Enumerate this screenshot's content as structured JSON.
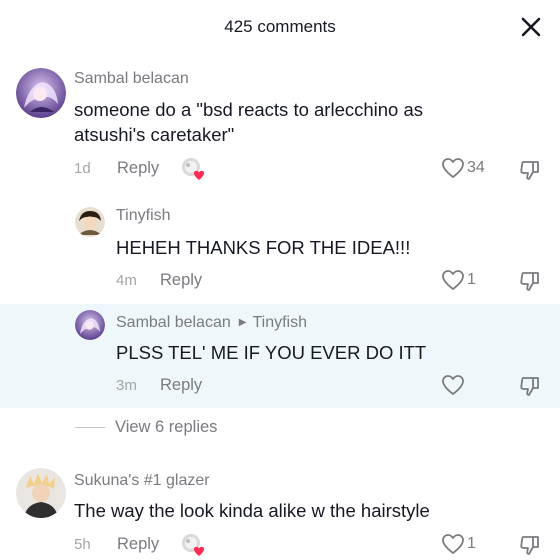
{
  "header": {
    "title": "425 comments",
    "close_icon": "close-icon"
  },
  "comments": [
    {
      "username": "Sambal belacan",
      "text_lines": [
        "someone do a \"bsd reacts to arlecchino as",
        "atsushi's caretaker\""
      ],
      "time": "1d",
      "reply_label": "Reply",
      "likes": "34",
      "creator_liked": true
    },
    {
      "username": "Tinyfish",
      "text_lines": [
        "HEHEH THANKS FOR THE IDEA!!!"
      ],
      "time": "4m",
      "reply_label": "Reply",
      "likes": "1"
    },
    {
      "username": "Sambal belacan",
      "reply_to": "Tinyfish",
      "text_lines": [
        "PLSS TEL' ME IF YOU EVER DO ITT"
      ],
      "time": "3m",
      "reply_label": "Reply",
      "likes": "",
      "highlighted": true
    },
    {
      "username": "Sukuna's #1 glazer",
      "text_lines": [
        "The way the look kinda alike w the hairstyle"
      ],
      "time": "5h",
      "reply_label": "Reply",
      "likes": "1",
      "creator_liked": true
    }
  ],
  "view_replies_label": "View 6 replies",
  "colors": {
    "highlight_bg": "#eef8fa",
    "creator_heart": "#fe2c55",
    "secondary_text": "#7a7b80"
  }
}
